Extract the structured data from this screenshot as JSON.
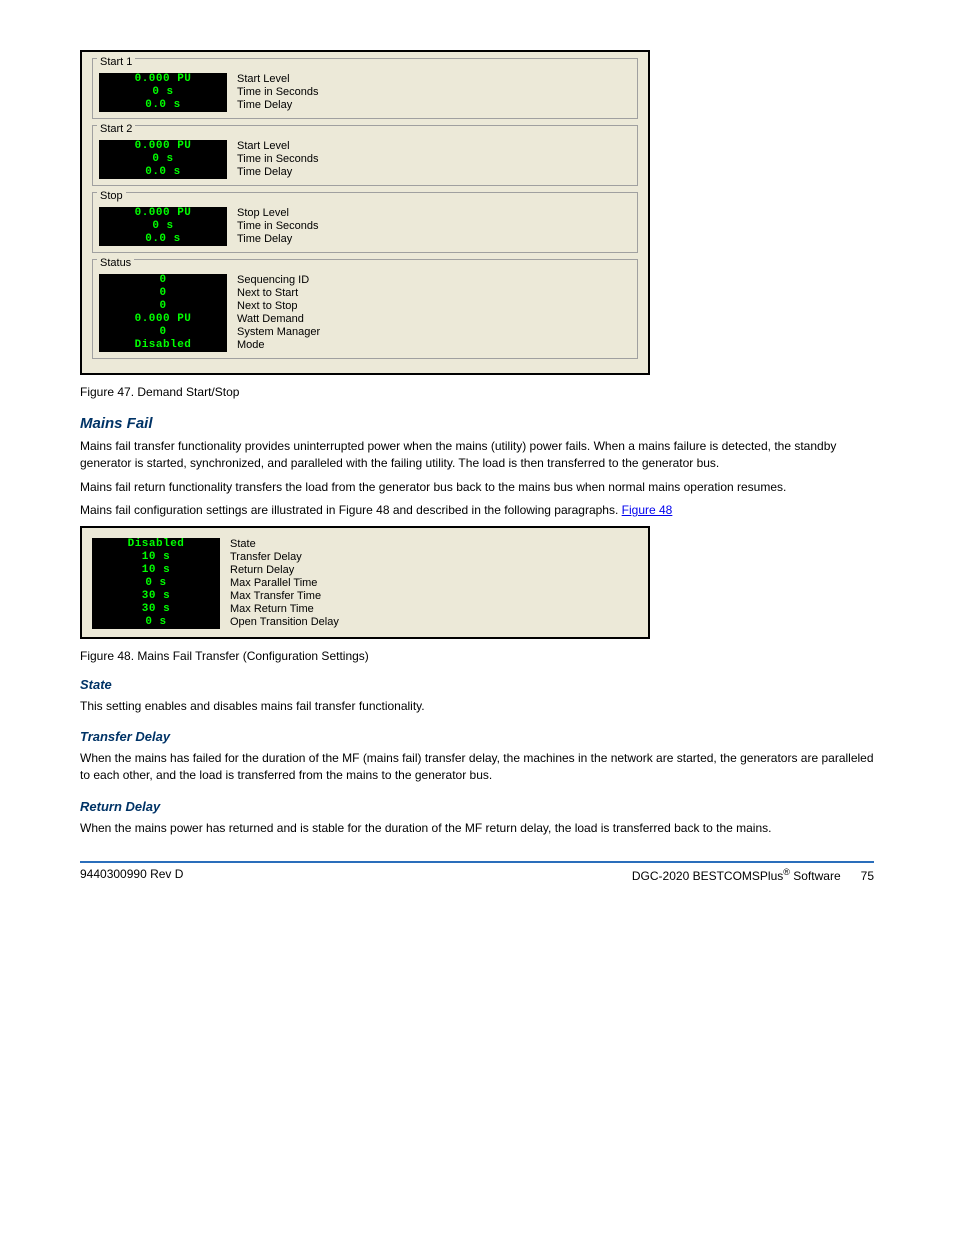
{
  "panel1": {
    "groups": [
      {
        "title": "Start 1",
        "rows": [
          {
            "value": "0.000 PU",
            "label": "Start Level"
          },
          {
            "value": "0 s",
            "label": "Time in Seconds"
          },
          {
            "value": "0.0 s",
            "label": "Time Delay"
          }
        ]
      },
      {
        "title": "Start 2",
        "rows": [
          {
            "value": "0.000 PU",
            "label": "Start Level"
          },
          {
            "value": "0 s",
            "label": "Time in Seconds"
          },
          {
            "value": "0.0 s",
            "label": "Time Delay"
          }
        ]
      },
      {
        "title": "Stop",
        "rows": [
          {
            "value": "0.000 PU",
            "label": "Stop Level"
          },
          {
            "value": "0 s",
            "label": "Time in Seconds"
          },
          {
            "value": "0.0 s",
            "label": "Time Delay"
          }
        ]
      },
      {
        "title": "Status",
        "rows": [
          {
            "value": "0",
            "label": "Sequencing ID"
          },
          {
            "value": "0",
            "label": "Next to Start"
          },
          {
            "value": "0",
            "label": "Next to Stop"
          },
          {
            "value": "0.000 PU",
            "label": "Watt Demand"
          },
          {
            "value": "0",
            "label": "System Manager"
          },
          {
            "value": "Disabled",
            "label": "Mode"
          }
        ]
      }
    ]
  },
  "caption1": "Figure 47. Demand Start/Stop",
  "heading_mains": "Mains Fail",
  "body1": "Mains fail transfer functionality provides uninterrupted power when the mains (utility) power fails. When a mains failure is detected, the standby generator is started, synchronized, and paralleled with the failing utility. The load is then transferred to the generator bus.",
  "body2": "Mains fail return functionality transfers the load from the generator bus back to the mains bus when normal mains operation resumes.",
  "body3": "Mains fail configuration settings are illustrated in Figure 48 and described in the following paragraphs.",
  "panel2": {
    "rows": [
      {
        "value": "Disabled",
        "label": "State"
      },
      {
        "value": "10 s",
        "label": "Transfer Delay"
      },
      {
        "value": "10 s",
        "label": "Return Delay"
      },
      {
        "value": "0 s",
        "label": "Max Parallel Time"
      },
      {
        "value": "30 s",
        "label": "Max Transfer Time"
      },
      {
        "value": "30 s",
        "label": "Max Return Time"
      },
      {
        "value": "0 s",
        "label": "Open Transition Delay"
      }
    ]
  },
  "caption2": "Figure 48. Mains Fail Transfer (Configuration Settings)",
  "sub_state": "State",
  "body_state": "This setting enables and disables mains fail transfer functionality.",
  "sub_transfer": "Transfer Delay",
  "body_transfer": "When the mains has failed for the duration of the MF (mains fail) transfer delay, the machines in the network are started, the generators are paralleled to each other, and the load is transferred from the mains to the generator bus.",
  "sub_return": "Return Delay",
  "body_return": "When the mains power has returned and is stable for the duration of the MF return delay, the load is transferred back to the mains.",
  "footer": {
    "left": "9440300990 Rev D",
    "right_pre": "DGC-2020 BESTCOMSPlus",
    "right_reg": "®",
    "right_post": " Software",
    "page": "75"
  }
}
